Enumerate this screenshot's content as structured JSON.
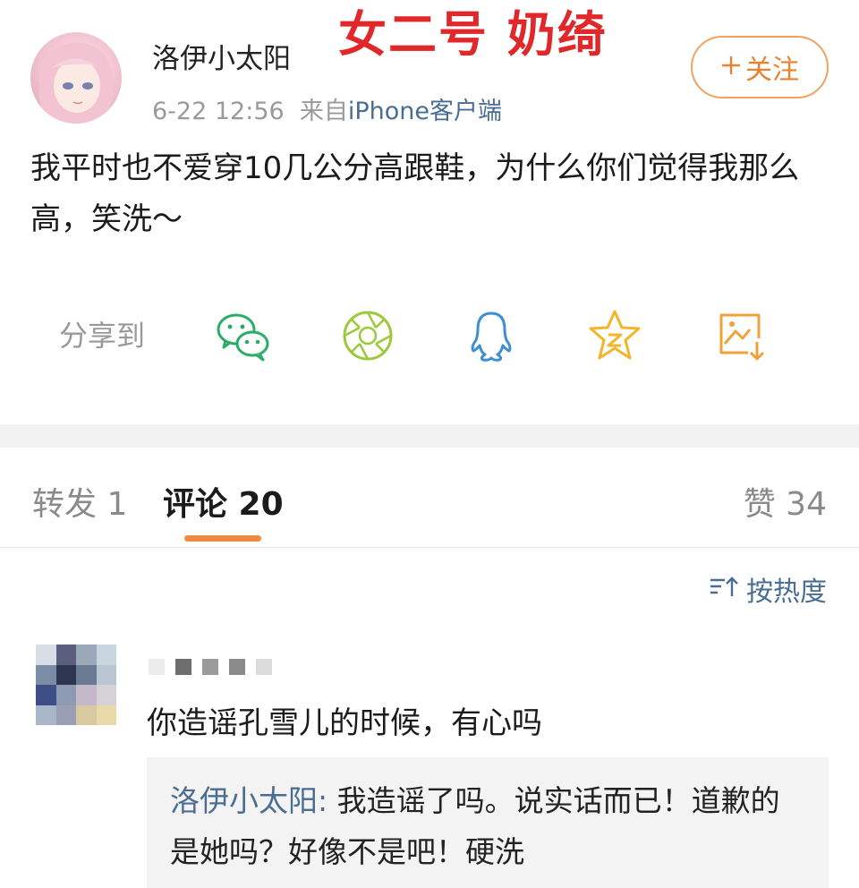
{
  "overlay_caption": "女二号 奶绮",
  "post": {
    "author": "洛伊小太阳",
    "date": "6-22 12:56",
    "from_prefix": "来自",
    "source": "iPhone客户端",
    "follow_label": "关注",
    "text": "我平时也不爱穿10几公分高跟鞋，为什么你们觉得我那么高，笑洗～"
  },
  "share": {
    "label": "分享到",
    "icons": [
      "wechat-icon",
      "moments-icon",
      "qq-icon",
      "qzone-icon",
      "save-image-icon"
    ]
  },
  "tabs": {
    "repost": "转发 1",
    "comments": "评论 20",
    "likes": "赞 34"
  },
  "sort": {
    "label": "按热度"
  },
  "comment": {
    "text": "你造谣孔雪儿的时候，有心吗",
    "reply": {
      "author": "洛伊小太阳:",
      "text": " 我造谣了吗。说实话而已！道歉的是她吗？好像不是吧！硬洗"
    }
  },
  "colors": {
    "accent_orange": "#f08a3c",
    "link_blue": "#4a6d93",
    "overlay_red": "#e0272a"
  }
}
